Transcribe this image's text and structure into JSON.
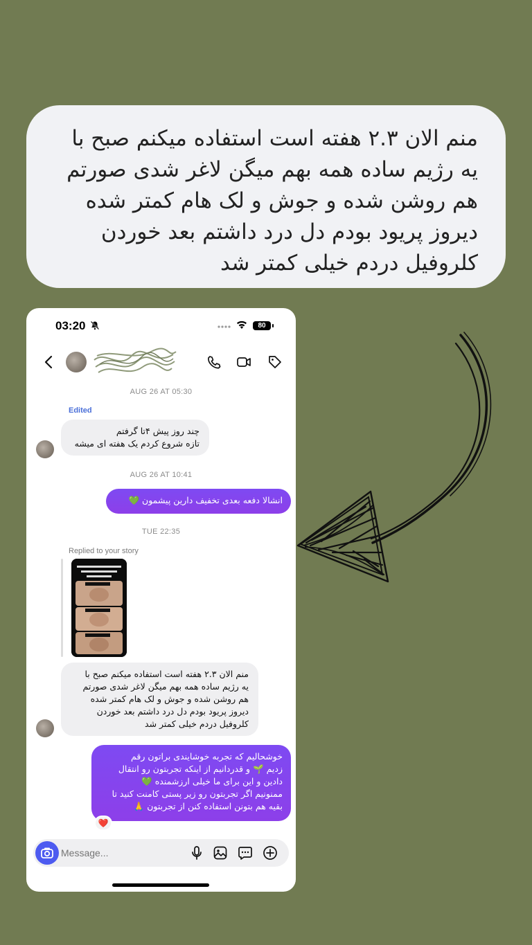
{
  "quote": {
    "lines": [
      "منم الان ۲.۳ هفته است استفاده میکنم صبح با",
      "یه رژیم ساده همه بهم میگن لاغر شدی صورتم",
      "هم روشن شده و جوش و لک هام کمتر شده",
      "دیروز پریود بودم دل درد داشتم بعد خوردن",
      "کلروفیل دردم خیلی کمتر شد"
    ]
  },
  "status_bar": {
    "time": "03:20",
    "battery": "80"
  },
  "chat": {
    "stamp1": "AUG 26 AT 05:30",
    "edited": "Edited",
    "msg1": [
      "چند روز پیش ۴تا گرفتم",
      "تازه شروع کردم یک هفته ای میشه"
    ],
    "stamp2": "AUG 26 AT 10:41",
    "msg2": "انشالا دفعه بعدی تخفیف دارین پیشمون 💚",
    "stamp3": "TUE 22:35",
    "replied": "Replied to your story",
    "msg3": [
      "منم الان ۲.۳ هفته است استفاده میکنم صبح با",
      "یه رژیم ساده همه بهم میگن لاغر شدی صورتم",
      "هم روشن شده و جوش و لک هام کمتر شده",
      "دیروز پریود بودم دل درد داشتم بعد خوردن",
      "کلروفیل دردم خیلی کمتر شد"
    ],
    "msg4": [
      "خوشحالیم که تجربه خوشایندی براتون رقم",
      "زدیم 🌱 و قدردانیم از اینکه تجربتون رو انتقال",
      "دادین و این برای ما خیلی ارزشمنده 💚",
      "ممنونیم اگر تجربتون رو زیر پستی کامنت کنید تا",
      "بقیه هم بتونن استفاده کنن از تجربتون 🙏"
    ],
    "reaction": "❤️"
  },
  "composer": {
    "placeholder": "Message..."
  },
  "colors": {
    "background": "#717b52",
    "outgoing": "#8a3df0",
    "incoming": "#efeff1",
    "camera": "#4d5bf0"
  }
}
